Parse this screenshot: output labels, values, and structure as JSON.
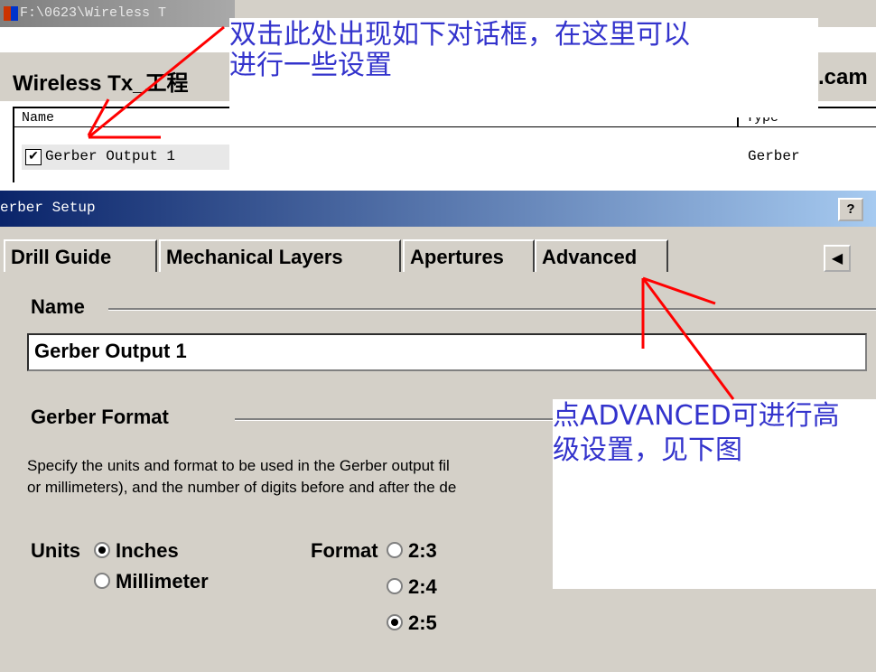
{
  "window": {
    "title": "F:\\0623\\Wireless T"
  },
  "project": {
    "title": "Wireless Tx_工程",
    "ext": ".cam"
  },
  "filelist": {
    "columns": [
      "Name",
      "Type"
    ],
    "rows": [
      {
        "checked": true,
        "name": "Gerber Output 1",
        "type": "Gerber"
      }
    ]
  },
  "dialog": {
    "title": "erber Setup",
    "help": "?",
    "tabs": [
      "Drill Guide",
      "Mechanical Layers",
      "Apertures",
      "Advanced"
    ],
    "tab_scroll": "◀",
    "name_label": "Name",
    "name_value": "Gerber Output 1",
    "format_section": "Gerber Format",
    "description_line1": "Specify the units and format to be used in the Gerber output fil",
    "description_line2": "or millimeters), and the number of digits before and after the de",
    "units_label": "Units",
    "units_options": [
      {
        "label": "Inches",
        "selected": true
      },
      {
        "label": "Millimeter",
        "selected": false
      }
    ],
    "format_label": "Format",
    "format_options": [
      {
        "label": "2:3",
        "selected": false
      },
      {
        "label": "2:4",
        "selected": false
      },
      {
        "label": "2:5",
        "selected": true
      }
    ]
  },
  "annotations": {
    "note1": [
      "双击此处出现如下对话框，在这里可以",
      "进行一些设置"
    ],
    "note2": [
      "点ADVANCED可进行高",
      "级设置，见下图"
    ],
    "arrow_color": "#ff0000",
    "text_color": "#3333cc"
  }
}
